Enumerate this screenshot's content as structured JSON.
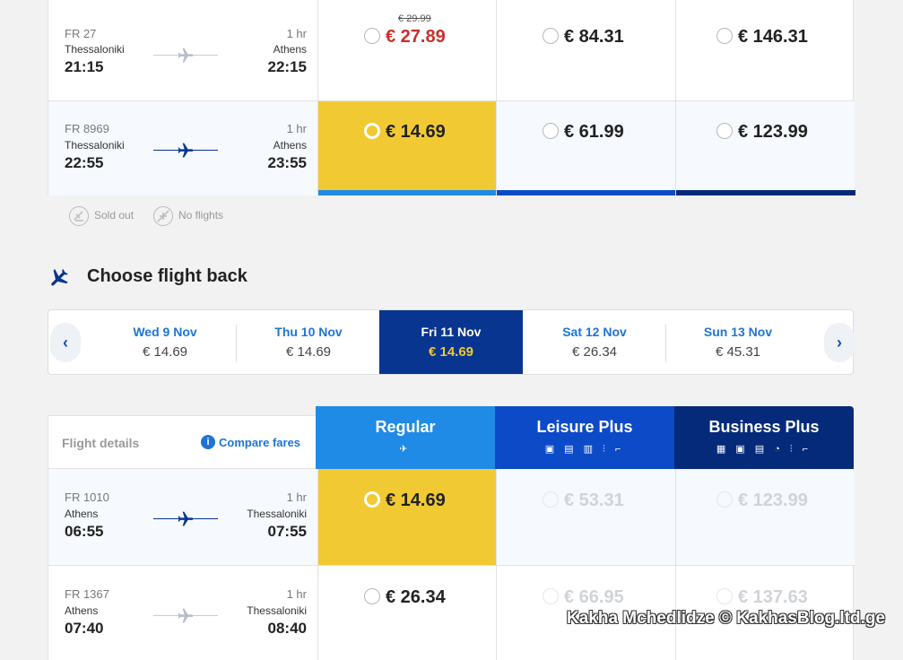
{
  "colors": {
    "selected_fare": "#f1c933",
    "regular": "#1f8be6",
    "leisure_plus": "#0c4ac8",
    "business_plus": "#062a7a",
    "sale_red": "#c8302a",
    "plane_blue": "#07358f",
    "plane_gray": "#b5bcc6"
  },
  "outbound": {
    "rows": [
      {
        "flight_no": "FR 27",
        "from_city": "Thessaloniki",
        "dep_time": "21:15",
        "duration": "1 hr",
        "to_city": "Athens",
        "arr_time": "22:15",
        "plane_icon": "plane-gray-icon",
        "fares": [
          {
            "old_price": "€ 29.99",
            "price": "€ 27.89",
            "state": "sale"
          },
          {
            "price": "€ 84.31",
            "state": "available"
          },
          {
            "price": "€ 146.31",
            "state": "available"
          }
        ]
      },
      {
        "flight_no": "FR 8969",
        "from_city": "Thessaloniki",
        "dep_time": "22:55",
        "duration": "1 hr",
        "to_city": "Athens",
        "arr_time": "23:55",
        "plane_icon": "plane-blue-icon",
        "fares": [
          {
            "price": "€ 14.69",
            "state": "selected"
          },
          {
            "price": "€ 61.99",
            "state": "available"
          },
          {
            "price": "€ 123.99",
            "state": "available"
          }
        ]
      }
    ]
  },
  "legend": {
    "sold_out": "Sold out",
    "no_flights": "No flights"
  },
  "return_heading": "Choose flight back",
  "date_selector": {
    "days": [
      {
        "label": "Wed 9 Nov",
        "price": "€ 14.69",
        "selected": false
      },
      {
        "label": "Thu 10 Nov",
        "price": "€ 14.69",
        "selected": false
      },
      {
        "label": "Fri 11 Nov",
        "price": "€ 14.69",
        "selected": true
      },
      {
        "label": "Sat 12 Nov",
        "price": "€ 26.34",
        "selected": false
      },
      {
        "label": "Sun 13 Nov",
        "price": "€ 45.31",
        "selected": false
      }
    ]
  },
  "fare_table": {
    "flight_details_label": "Flight details",
    "compare_fares_label": "Compare fares",
    "headers": [
      {
        "title": "Regular",
        "icons": "✈"
      },
      {
        "title": "Leisure Plus",
        "icons": "▣ ▤ ▥ ⫶ ⌐"
      },
      {
        "title": "Business Plus",
        "icons": "▦ ▣ ▤ ◔ ⫶ ⌐"
      }
    ]
  },
  "inbound": {
    "rows": [
      {
        "flight_no": "FR 1010",
        "from_city": "Athens",
        "dep_time": "06:55",
        "duration": "1 hr",
        "to_city": "Thessaloniki",
        "arr_time": "07:55",
        "plane_icon": "plane-blue-icon",
        "fares": [
          {
            "price": "€ 14.69",
            "state": "selected"
          },
          {
            "price": "€ 53.31",
            "state": "disabled"
          },
          {
            "price": "€ 123.99",
            "state": "disabled"
          }
        ]
      },
      {
        "flight_no": "FR 1367",
        "from_city": "Athens",
        "dep_time": "07:40",
        "duration": "1 hr",
        "to_city": "Thessaloniki",
        "arr_time": "08:40",
        "plane_icon": "plane-gray-icon",
        "fares": [
          {
            "price": "€ 26.34",
            "state": "available"
          },
          {
            "price": "€ 66.95",
            "state": "disabled"
          },
          {
            "price": "€ 137.63",
            "state": "disabled"
          }
        ]
      }
    ]
  },
  "watermark": "Kakha Mchedlidze © KakhasBlog.ltd.ge"
}
